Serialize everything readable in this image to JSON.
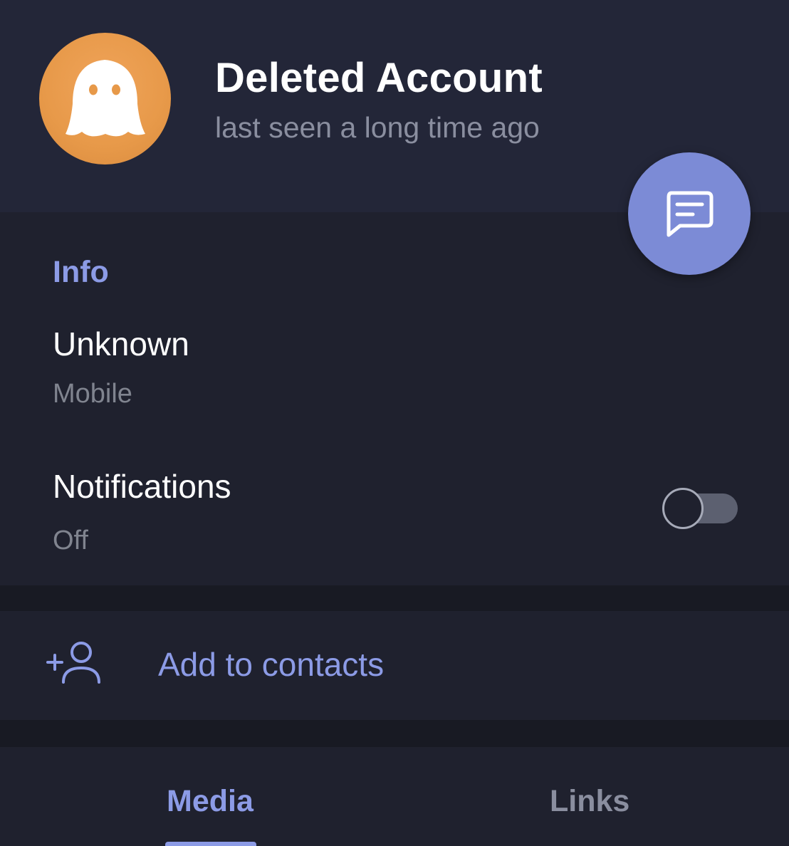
{
  "profile": {
    "name": "Deleted Account",
    "status": "last seen a long time ago",
    "avatar_icon": "ghost-icon",
    "avatar_color": "#e79949"
  },
  "fab": {
    "icon": "message-icon",
    "color": "#7c8bd6"
  },
  "info": {
    "heading": "Info",
    "phone_value": "Unknown",
    "phone_label": "Mobile",
    "notifications_label": "Notifications",
    "notifications_value": "Off",
    "notifications_enabled": false
  },
  "actions": {
    "add_contact_label": "Add to contacts",
    "add_contact_icon": "add-user-icon"
  },
  "tabs": {
    "items": [
      {
        "label": "Media",
        "active": true
      },
      {
        "label": "Links",
        "active": false
      }
    ]
  },
  "colors": {
    "accent": "#8c9be6",
    "background": "#1f212e",
    "header": "#232638"
  }
}
